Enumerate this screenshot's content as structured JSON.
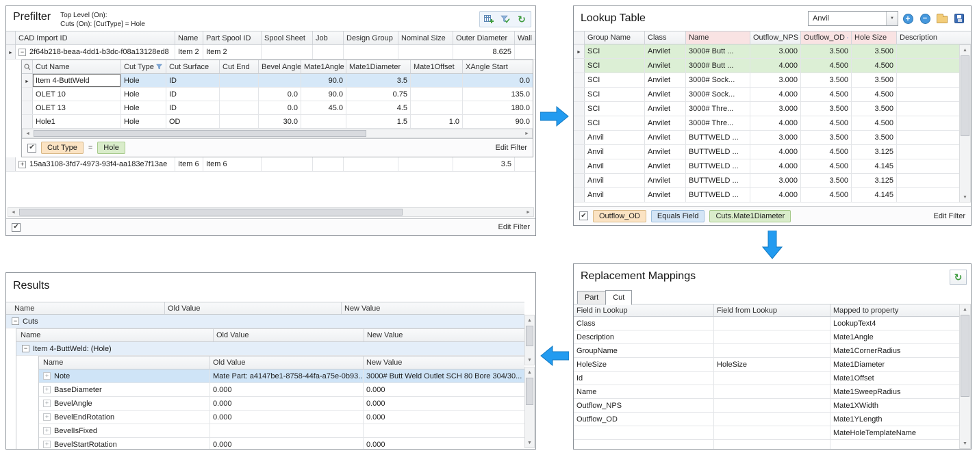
{
  "prefilter": {
    "title": "Prefilter",
    "subtitle_line1": "Top Level (On):",
    "subtitle_line2": "Cuts (On): [CutType] = Hole",
    "toolbar_icons": [
      "new-filter-icon",
      "filter-check-icon",
      "refresh-icon"
    ],
    "columns": [
      "CAD Import ID",
      "Name",
      "Part Spool ID",
      "Spool Sheet",
      "Job",
      "Design Group",
      "Nominal Size",
      "Outer Diameter",
      "Wall"
    ],
    "rows": [
      {
        "cad_import_id": "2f64b218-beaa-4dd1-b3dc-f08a13128ed8",
        "name": "Item 2",
        "part_spool_id": "Item 2",
        "outer_diameter": "8.625"
      },
      {
        "cad_import_id": "15aa3108-3fd7-4973-93f4-aa183e7f13ae",
        "name": "Item 6",
        "part_spool_id": "Item 6",
        "outer_diameter": "3.5"
      }
    ],
    "detail": {
      "columns": [
        "Cut Name",
        "Cut Type",
        "Cut Surface",
        "Cut End",
        "Bevel Angle",
        "Mate1Angle",
        "Mate1Diameter",
        "Mate1Offset",
        "XAngle Start"
      ],
      "rows": [
        {
          "cut_name": "Item 4-ButtWeld",
          "cut_type": "Hole",
          "cut_surface": "ID",
          "cut_end": "",
          "bevel_angle": "",
          "mate1_angle": "90.0",
          "mate1_diameter": "3.5",
          "mate1_offset": "",
          "xangle_start": "0.0"
        },
        {
          "cut_name": "OLET 10",
          "cut_type": "Hole",
          "cut_surface": "ID",
          "cut_end": "",
          "bevel_angle": "0.0",
          "mate1_angle": "90.0",
          "mate1_diameter": "0.75",
          "mate1_offset": "",
          "xangle_start": "135.0"
        },
        {
          "cut_name": "OLET 13",
          "cut_type": "Hole",
          "cut_surface": "ID",
          "cut_end": "",
          "bevel_angle": "0.0",
          "mate1_angle": "45.0",
          "mate1_diameter": "4.5",
          "mate1_offset": "",
          "xangle_start": "180.0"
        },
        {
          "cut_name": "Hole1",
          "cut_type": "Hole",
          "cut_surface": "OD",
          "cut_end": "",
          "bevel_angle": "30.0",
          "mate1_angle": "",
          "mate1_diameter": "1.5",
          "mate1_offset": "1.0",
          "xangle_start": "90.0"
        }
      ],
      "filter_field": "Cut Type",
      "filter_operator": "=",
      "filter_value": "Hole",
      "edit_filter": "Edit Filter"
    },
    "edit_filter": "Edit Filter"
  },
  "lookup": {
    "title": "Lookup Table",
    "combo_value": "Anvil",
    "toolbar_icons": [
      "add-row-icon",
      "remove-row-icon",
      "open-folder-icon",
      "save-icon"
    ],
    "columns": [
      "Group Name",
      "Class",
      "Name",
      "Outflow_NPS",
      "Outflow_OD",
      "Hole Size",
      "Description"
    ],
    "rows": [
      {
        "group_name": "SCI",
        "class": "Anvilet",
        "name": "3000# Butt ...",
        "outflow_nps": "3.000",
        "outflow_od": "3.500",
        "hole_size": "3.500",
        "description": ""
      },
      {
        "group_name": "SCI",
        "class": "Anvilet",
        "name": "3000# Butt ...",
        "outflow_nps": "4.000",
        "outflow_od": "4.500",
        "hole_size": "4.500",
        "description": ""
      },
      {
        "group_name": "SCI",
        "class": "Anvilet",
        "name": "3000# Sock...",
        "outflow_nps": "3.000",
        "outflow_od": "3.500",
        "hole_size": "3.500",
        "description": ""
      },
      {
        "group_name": "SCI",
        "class": "Anvilet",
        "name": "3000# Sock...",
        "outflow_nps": "4.000",
        "outflow_od": "4.500",
        "hole_size": "4.500",
        "description": ""
      },
      {
        "group_name": "SCI",
        "class": "Anvilet",
        "name": "3000# Thre...",
        "outflow_nps": "3.000",
        "outflow_od": "3.500",
        "hole_size": "3.500",
        "description": ""
      },
      {
        "group_name": "SCI",
        "class": "Anvilet",
        "name": "3000# Thre...",
        "outflow_nps": "4.000",
        "outflow_od": "4.500",
        "hole_size": "4.500",
        "description": ""
      },
      {
        "group_name": "Anvil",
        "class": "Anvilet",
        "name": "BUTTWELD ...",
        "outflow_nps": "3.000",
        "outflow_od": "3.500",
        "hole_size": "3.500",
        "description": ""
      },
      {
        "group_name": "Anvil",
        "class": "Anvilet",
        "name": "BUTTWELD ...",
        "outflow_nps": "4.000",
        "outflow_od": "4.500",
        "hole_size": "3.125",
        "description": ""
      },
      {
        "group_name": "Anvil",
        "class": "Anvilet",
        "name": "BUTTWELD ...",
        "outflow_nps": "4.000",
        "outflow_od": "4.500",
        "hole_size": "4.145",
        "description": ""
      },
      {
        "group_name": "Anvil",
        "class": "Anvilet",
        "name": "BUTTWELD ...",
        "outflow_nps": "3.000",
        "outflow_od": "3.500",
        "hole_size": "3.125",
        "description": ""
      },
      {
        "group_name": "Anvil",
        "class": "Anvilet",
        "name": "BUTTWELD ...",
        "outflow_nps": "4.000",
        "outflow_od": "4.500",
        "hole_size": "4.145",
        "description": ""
      }
    ],
    "filter_field": "Outflow_OD",
    "filter_operator": "Equals Field",
    "filter_value": "Cuts.Mate1Diameter",
    "edit_filter": "Edit Filter"
  },
  "results": {
    "title": "Results",
    "columns": [
      "Name",
      "Old Value",
      "New Value"
    ],
    "group1_label": "Cuts",
    "level1_columns": [
      "Name",
      "Old Value",
      "New Value"
    ],
    "group2_label": "Item 4-ButtWeld: (Hole)",
    "level2_columns": [
      "Name",
      "Old Value",
      "New Value"
    ],
    "rows": [
      {
        "name": "Note",
        "old_value": "Mate Part: a4147be1-8758-44fa-a75e-0b93...",
        "new_value": "3000# Butt Weld Outlet SCH 80 Bore 304/30..."
      },
      {
        "name": "BaseDiameter",
        "old_value": "0.000",
        "new_value": "0.000"
      },
      {
        "name": "BevelAngle",
        "old_value": "0.000",
        "new_value": "0.000"
      },
      {
        "name": "BevelEndRotation",
        "old_value": "0.000",
        "new_value": "0.000"
      },
      {
        "name": "BevelIsFixed",
        "old_value": "",
        "new_value": ""
      },
      {
        "name": "BevelStartRotation",
        "old_value": "0.000",
        "new_value": "0.000"
      }
    ]
  },
  "mappings": {
    "title": "Replacement Mappings",
    "toolbar_icons": [
      "refresh-icon"
    ],
    "tabs": [
      "Part",
      "Cut"
    ],
    "active_tab": "Cut",
    "columns": [
      "Field in Lookup",
      "Field from Lookup",
      "Mapped to property"
    ],
    "rows": [
      {
        "field_in_lookup": "Class",
        "field_from_lookup": "",
        "mapped_to_property": "LookupText4"
      },
      {
        "field_in_lookup": "Description",
        "field_from_lookup": "",
        "mapped_to_property": "Mate1Angle"
      },
      {
        "field_in_lookup": "GroupName",
        "field_from_lookup": "",
        "mapped_to_property": "Mate1CornerRadius"
      },
      {
        "field_in_lookup": "HoleSize",
        "field_from_lookup": "HoleSize",
        "mapped_to_property": "Mate1Diameter"
      },
      {
        "field_in_lookup": "Id",
        "field_from_lookup": "",
        "mapped_to_property": "Mate1Offset"
      },
      {
        "field_in_lookup": "Name",
        "field_from_lookup": "",
        "mapped_to_property": "Mate1SweepRadius"
      },
      {
        "field_in_lookup": "Outflow_NPS",
        "field_from_lookup": "",
        "mapped_to_property": "Mate1XWidth"
      },
      {
        "field_in_lookup": "Outflow_OD",
        "field_from_lookup": "",
        "mapped_to_property": "Mate1YLength"
      },
      {
        "field_in_lookup": "",
        "field_from_lookup": "",
        "mapped_to_property": "MateHoleTemplateName"
      }
    ]
  }
}
